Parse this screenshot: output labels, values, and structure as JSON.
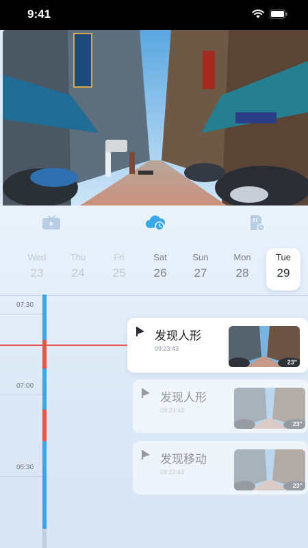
{
  "status_bar": {
    "time": "9:41"
  },
  "tabs": [
    {
      "icon": "tv-icon",
      "active": false
    },
    {
      "icon": "cloud-clock-icon",
      "active": true
    },
    {
      "icon": "sd-card-clock-icon",
      "active": false
    }
  ],
  "days": [
    {
      "weekday": "Wed",
      "date": "23"
    },
    {
      "weekday": "Thu",
      "date": "24"
    },
    {
      "weekday": "Fri",
      "date": "25"
    },
    {
      "weekday": "Sat",
      "date": "26"
    },
    {
      "weekday": "Sun",
      "date": "27"
    },
    {
      "weekday": "Mon",
      "date": "28"
    },
    {
      "weekday": "Tue",
      "date": "29",
      "selected": true
    }
  ],
  "timeline": {
    "labels": [
      "07:30",
      "07:00",
      "06:30"
    ]
  },
  "events": [
    {
      "title": "发现人形",
      "time": "09:23:43",
      "duration": "23\"",
      "active": true
    },
    {
      "title": "发现人形",
      "time": "09:23:43",
      "duration": "23\"",
      "active": false
    },
    {
      "title": "发现移动",
      "time": "09:23:43",
      "duration": "23\"",
      "active": false
    }
  ],
  "colors": {
    "accent": "#3aa8e8",
    "playhead": "#e8534a",
    "record_bar": "#3aa8e8",
    "alert_bar": "#e8534a"
  }
}
